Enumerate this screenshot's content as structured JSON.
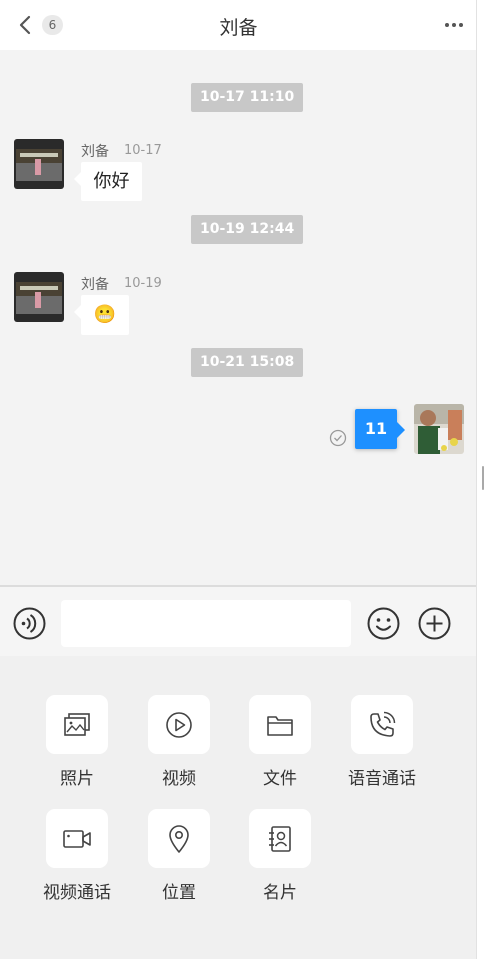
{
  "header": {
    "title": "刘备",
    "unread_count": "6"
  },
  "messages": {
    "t1": "10-17 11:10",
    "m1": {
      "sender": "刘备",
      "time": "10-17",
      "text": "你好"
    },
    "t2": "10-19 12:44",
    "m2": {
      "sender": "刘备",
      "time": "10-19",
      "emoji": "😬"
    },
    "t3": "10-21 15:08",
    "m3": {
      "text": "11"
    }
  },
  "input": {
    "value": "",
    "placeholder": ""
  },
  "tools": [
    {
      "label": "照片",
      "icon": "photo-icon"
    },
    {
      "label": "视频",
      "icon": "video-play-icon"
    },
    {
      "label": "文件",
      "icon": "folder-icon"
    },
    {
      "label": "语音通话",
      "icon": "phone-call-icon"
    },
    {
      "label": "视频通话",
      "icon": "video-camera-icon"
    },
    {
      "label": "位置",
      "icon": "location-pin-icon"
    },
    {
      "label": "名片",
      "icon": "contact-card-icon"
    }
  ],
  "colors": {
    "accent": "#1e90ff",
    "background": "#f3f3f3",
    "time_pill": "#c8c8c8"
  }
}
